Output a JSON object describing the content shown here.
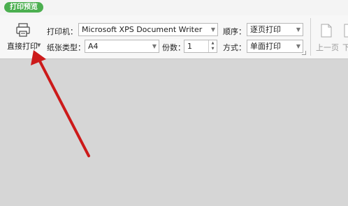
{
  "tab": {
    "label": "打印预览"
  },
  "toolbar": {
    "direct_print_label": "直接打印",
    "printer_label": "打印机：",
    "printer_value": "Microsoft XPS Document Writer",
    "order_label": "顺序：",
    "order_value": "逐页打印",
    "paper_label": "纸张类型：",
    "paper_value": "A4",
    "copies_label": "份数：",
    "copies_value": "1",
    "mode_label": "方式：",
    "mode_value": "单面打印",
    "prev_page_label": "上一页",
    "next_page_label": "下"
  },
  "colors": {
    "tab_green": "#4caf50",
    "arrow_red": "#cc1a1a"
  },
  "icons": [
    "printer-icon",
    "dropdown-arrow-icon",
    "page-icon",
    "annotation-arrow"
  ]
}
